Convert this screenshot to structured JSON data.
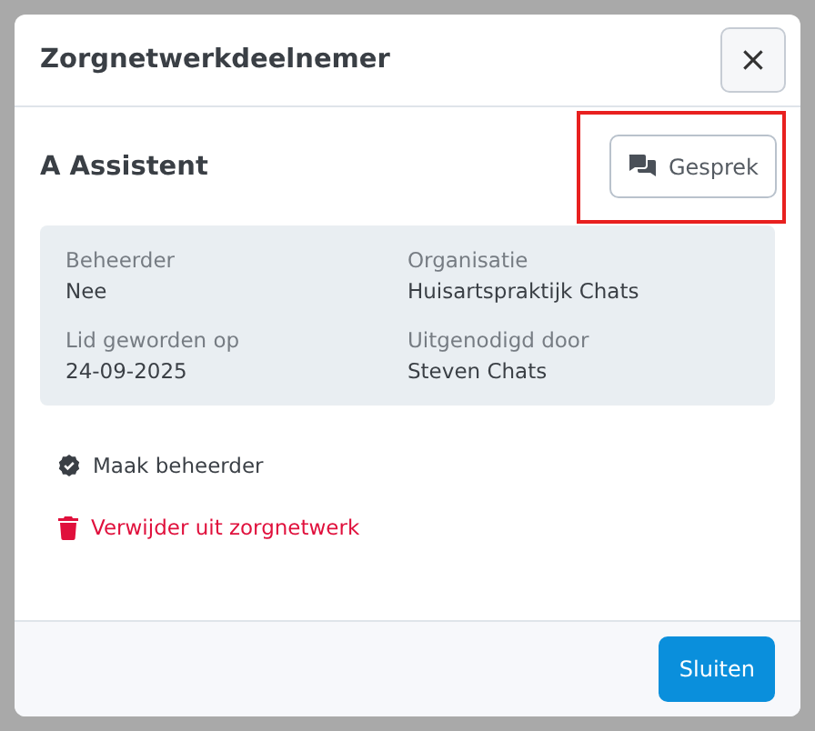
{
  "dialog": {
    "title": "Zorgnetwerkdeelnemer",
    "close_label": "×"
  },
  "participant": {
    "name": "A Assistent",
    "chat_button": "Gesprek",
    "highlighted": true
  },
  "details": [
    {
      "label": "Beheerder",
      "value": "Nee"
    },
    {
      "label": "Organisatie",
      "value": "Huisartspraktijk Chats"
    },
    {
      "label": "Lid geworden op",
      "value": "24-09-2025"
    },
    {
      "label": "Uitgenodigd door",
      "value": "Steven Chats"
    }
  ],
  "actions": [
    {
      "kind": "admin",
      "label": "Maak beheerder"
    },
    {
      "kind": "danger",
      "label": "Verwijder uit zorgnetwerk"
    }
  ],
  "footer": {
    "button": "Sluiten"
  }
}
